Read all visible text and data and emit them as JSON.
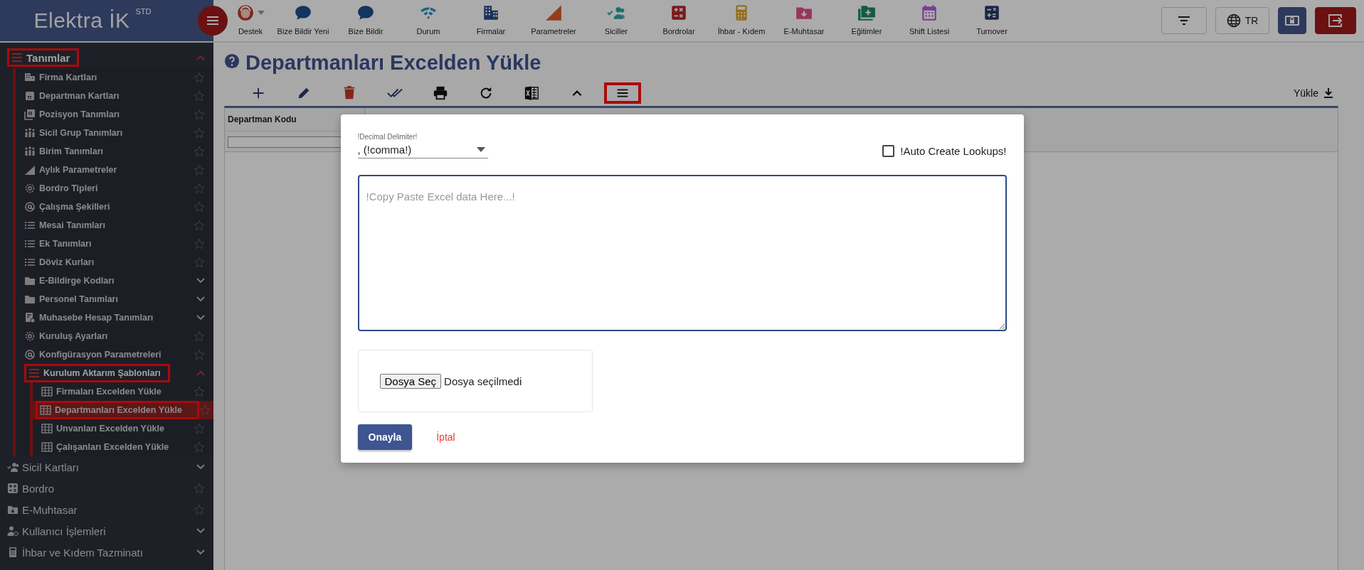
{
  "app": {
    "logo": "Elektra İK",
    "edition": "STD"
  },
  "nav": [
    {
      "label": "Destek",
      "has_menu": true
    },
    {
      "label": "Bize Bildir Yeni",
      "has_menu": false
    },
    {
      "label": "Bize Bildir",
      "has_menu": false
    },
    {
      "label": "Durum",
      "has_menu": false
    },
    {
      "label": "Firmalar",
      "has_menu": false
    },
    {
      "label": "Parametreler",
      "has_menu": false
    },
    {
      "label": "Siciller",
      "has_menu": false
    },
    {
      "label": "Bordrolar",
      "has_menu": false
    },
    {
      "label": "İhbar - Kıdem",
      "has_menu": false
    },
    {
      "label": "E-Muhtasar",
      "has_menu": false
    },
    {
      "label": "Eğitimler",
      "has_menu": false
    },
    {
      "label": "Shift Listesi",
      "has_menu": false
    },
    {
      "label": "Turnover",
      "has_menu": false
    }
  ],
  "top_actions": {
    "language": "TR"
  },
  "sidebar": {
    "items": [
      {
        "label": "Tanımlar",
        "expanded": true,
        "highlighted": true,
        "selected": false,
        "children": [
          {
            "label": "Firma Kartları",
            "starred": false,
            "selected": false
          },
          {
            "label": "Departman Kartları",
            "starred": false,
            "selected": false
          },
          {
            "label": "Pozisyon Tanımları",
            "starred": false,
            "selected": false
          },
          {
            "label": "Sicil Grup Tanımları",
            "starred": false,
            "selected": false
          },
          {
            "label": "Birim Tanımları",
            "starred": false,
            "selected": false
          },
          {
            "label": "Aylık Parametreler",
            "starred": false,
            "selected": false
          },
          {
            "label": "Bordro Tipleri",
            "starred": false,
            "selected": false
          },
          {
            "label": "Çalışma Şekilleri",
            "starred": false,
            "selected": false
          },
          {
            "label": "Mesai Tanımları",
            "starred": false,
            "selected": false
          },
          {
            "label": "Ek Tanımları",
            "starred": false,
            "selected": false
          },
          {
            "label": "Döviz Kurları",
            "starred": false,
            "selected": false
          },
          {
            "label": "E-Bildirge Kodları",
            "expanded": false,
            "selected": false
          },
          {
            "label": "Personel Tanımları",
            "expanded": false,
            "selected": false
          },
          {
            "label": "Muhasebe Hesap Tanımları",
            "expanded": false,
            "selected": false
          },
          {
            "label": "Kuruluş Ayarları",
            "starred": false,
            "selected": false
          },
          {
            "label": "Konfigürasyon Parametreleri",
            "starred": false,
            "selected": false
          },
          {
            "label": "Kurulum Aktarım Şablonları",
            "expanded": true,
            "highlighted": true,
            "selected": false,
            "children": [
              {
                "label": "Firmaları Excelden Yükle",
                "starred": false,
                "selected": false
              },
              {
                "label": "Departmanları Excelden Yükle",
                "starred": false,
                "selected": true,
                "highlighted": true
              },
              {
                "label": "Unvanları Excelden Yükle",
                "starred": false,
                "selected": false
              },
              {
                "label": "Çalışanları Excelden Yükle",
                "starred": false,
                "selected": false
              }
            ]
          }
        ]
      },
      {
        "label": "Sicil Kartları",
        "expanded": false,
        "selected": false
      },
      {
        "label": "Bordro",
        "starred": false,
        "selected": false
      },
      {
        "label": "E-Muhtasar",
        "starred": false,
        "selected": false
      },
      {
        "label": "Kullanıcı İşlemleri",
        "expanded": false,
        "selected": false
      },
      {
        "label": "İhbar ve Kıdem Tazminatı",
        "expanded": false,
        "selected": false
      }
    ]
  },
  "page": {
    "title": "Departmanları Excelden Yükle",
    "toolbar": [
      {
        "highlighted": false
      },
      {
        "highlighted": false
      },
      {
        "highlighted": false
      },
      {
        "highlighted": false
      },
      {
        "highlighted": false
      },
      {
        "highlighted": false
      },
      {
        "highlighted": false
      },
      {
        "highlighted": false
      },
      {
        "highlighted": true
      }
    ],
    "upload_label": "Yükle",
    "table": {
      "columns": [
        "Departman Kodu"
      ]
    }
  },
  "dialog": {
    "delimiter": {
      "label": "!Decimal Delimiter!",
      "value": ", (!comma!)"
    },
    "auto_create": {
      "label": "!Auto Create Lookups!",
      "checked": false
    },
    "paste": {
      "placeholder": "!Copy Paste Excel data Here...!"
    },
    "file": {
      "button": "Dosya Seç",
      "status": "Dosya seçilmedi"
    },
    "confirm": "Onayla",
    "cancel": "İptal"
  }
}
